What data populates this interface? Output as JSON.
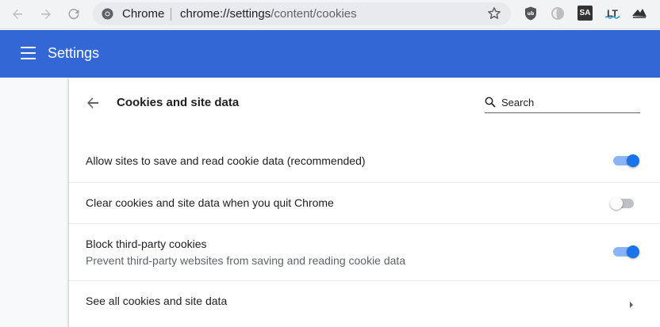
{
  "browser": {
    "omnibox_site": "Chrome",
    "omnibox_url_host": "chrome://settings",
    "omnibox_url_path": "/content/cookies",
    "icons": [
      "back-icon",
      "forward-icon",
      "reload-icon",
      "chrome-icon",
      "bookmark-star-icon",
      "ublock-icon",
      "gray-extension-icon",
      "sa-extension-icon",
      "languagetool-icon",
      "shark-extension-icon"
    ],
    "extensions": {
      "sa_label": "SA",
      "lt_label": "LT"
    }
  },
  "header": {
    "title": "Settings",
    "accent_color": "#3367d6"
  },
  "page": {
    "title": "Cookies and site data",
    "search_placeholder": "Search",
    "rows": [
      {
        "label": "Allow sites to save and read cookie data (recommended)",
        "enabled": true
      },
      {
        "label": "Clear cookies and site data when you quit Chrome",
        "enabled": false
      },
      {
        "label": "Block third-party cookies",
        "sublabel": "Prevent third-party websites from saving and reading cookie data",
        "enabled": true
      },
      {
        "label": "See all cookies and site data"
      }
    ]
  }
}
